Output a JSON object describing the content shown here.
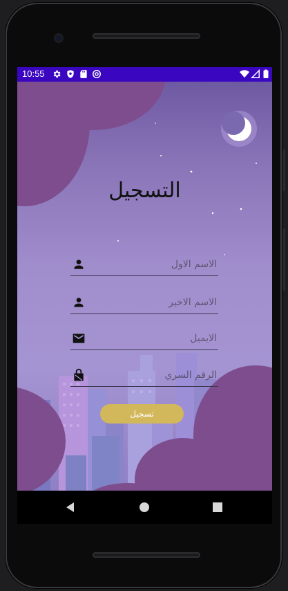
{
  "status_bar": {
    "time": "10:55",
    "left_icons": [
      "gear-icon",
      "shield-icon",
      "sd-card-icon",
      "at-sign-icon"
    ],
    "right_icons": [
      "wifi-icon",
      "signal-icon",
      "battery-icon"
    ],
    "background": "#3a06c0"
  },
  "screen": {
    "title": "التسجيل",
    "fields": [
      {
        "placeholder": "الاسم الاول",
        "icon": "person-icon"
      },
      {
        "placeholder": "الاسم الاخير",
        "icon": "person-icon"
      },
      {
        "placeholder": "الايميل",
        "icon": "mail-icon"
      },
      {
        "placeholder": "الرقم السري",
        "icon": "lock-icon"
      }
    ],
    "submit_label": "تسجيل",
    "accent": "#d3b75b",
    "cloud_color": "#7d4d8e"
  },
  "nav": {
    "buttons": [
      "back-icon",
      "home-icon",
      "recents-icon"
    ]
  }
}
